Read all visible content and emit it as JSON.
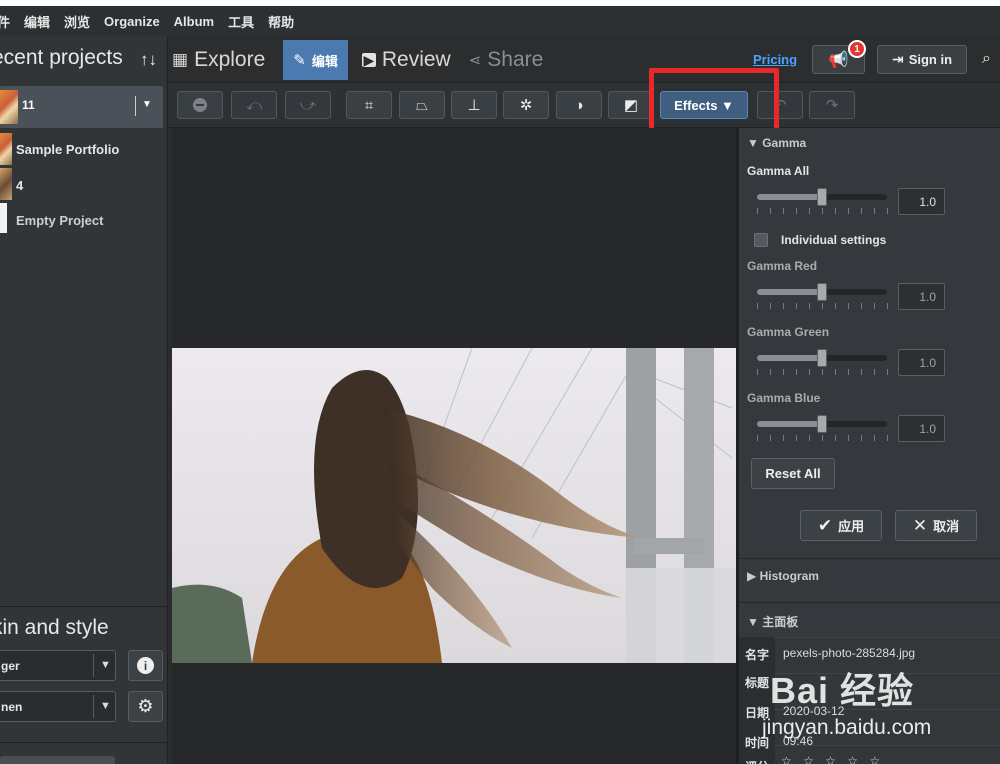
{
  "menu": {
    "items": [
      "件",
      "编辑",
      "浏览",
      "Organize",
      "Album",
      "工具",
      "帮助"
    ]
  },
  "left_panel": {
    "title": "ecent projects",
    "selected_project": "11",
    "projects": [
      {
        "label": "Sample Portfolio"
      },
      {
        "label": "4"
      },
      {
        "label": "Empty Project"
      }
    ],
    "skin_title": "kin and style",
    "skin_select_value": "ger",
    "lang_select_value": "nen"
  },
  "nav": {
    "tabs": [
      {
        "label": "Explore",
        "state": "normal"
      },
      {
        "label": "编辑",
        "state": "active"
      },
      {
        "label": "Review",
        "state": "normal"
      },
      {
        "label": "Share",
        "state": "disabled"
      }
    ],
    "pricing": "Pricing",
    "notification_count": "1",
    "sign_in": "Sign in"
  },
  "toolbar": {
    "effects_label": "Effects ▼"
  },
  "right_panel": {
    "gamma_section": "▼ Gamma",
    "gamma_all_label": "Gamma All",
    "gamma_all_value": "1.0",
    "individual_settings_label": "Individual settings",
    "individual_settings_checked": false,
    "gamma_red_label": "Gamma Red",
    "gamma_red_value": "1.0",
    "gamma_green_label": "Gamma Green",
    "gamma_green_value": "1.0",
    "gamma_blue_label": "Gamma Blue",
    "gamma_blue_value": "1.0",
    "slider_level": 0.5,
    "reset_all": "Reset All",
    "apply": "应用",
    "cancel": "取消",
    "histogram_section": "▶ Histogram",
    "main_panel_section": "▼ 主面板",
    "info": {
      "name_label": "名字",
      "name_value": "pexels-photo-285284.jpg",
      "title_label": "标题",
      "date_label": "日期",
      "date_value": "2020-03-12",
      "time_label": "时间",
      "time_value": "09:46",
      "rating_label": "评分",
      "rating_value": "☆ ☆ ☆ ☆ ☆"
    }
  },
  "watermark": {
    "logo": "Bai 经验",
    "url": "jingyan.baidu.com"
  },
  "colors": {
    "accent": "#4a7ab0",
    "highlight_box": "#e8292c",
    "link": "#4aa3ff",
    "badge": "#e43535"
  }
}
